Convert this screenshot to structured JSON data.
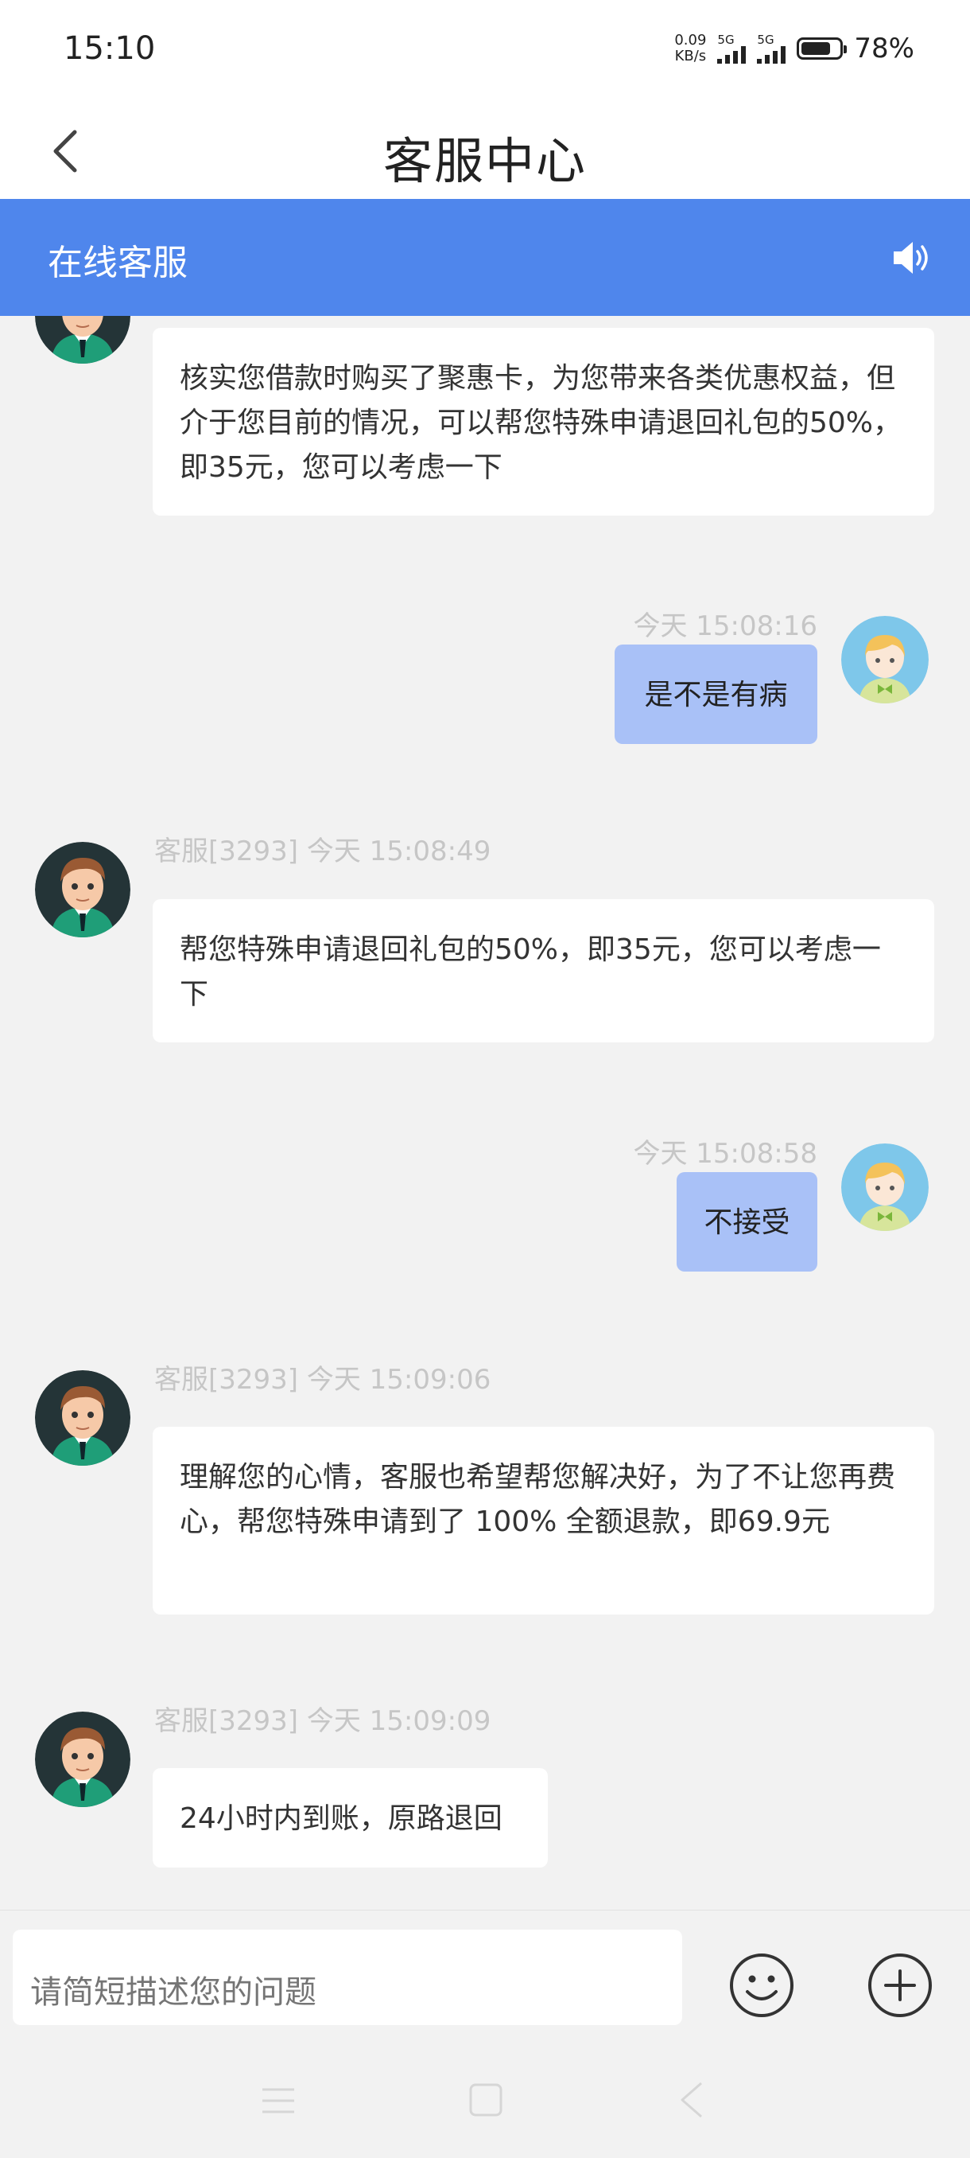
{
  "status": {
    "time": "15:10",
    "net_speed_top": "0.09",
    "net_speed_bottom": "KB/s",
    "sim1": "5G",
    "sim2": "5G",
    "battery": "78%",
    "battery_level": 0.78
  },
  "header": {
    "title": "客服中心",
    "banner_title": "在线客服"
  },
  "messages": [
    {
      "from": "agent",
      "meta": "",
      "text": "核实您借款时购买了聚惠卡，为您带来各类优惠权益，但介于您目前的情况，可以帮您特殊申请退回礼包的50%，即35元，您可以考虑一下"
    },
    {
      "from": "user",
      "meta": "今天 15:08:16",
      "text": "是不是有病"
    },
    {
      "from": "agent",
      "meta": "客服[3293]  今天 15:08:49",
      "text": "帮您特殊申请退回礼包的50%，即35元，您可以考虑一下"
    },
    {
      "from": "user",
      "meta": "今天 15:08:58",
      "text": "不接受"
    },
    {
      "from": "agent",
      "meta": "客服[3293]  今天 15:09:06",
      "text": "理解您的心情，客服也希望帮您解决好，为了不让您再费心，帮您特殊申请到了 100% 全额退款，即69.9元"
    },
    {
      "from": "agent",
      "meta": "客服[3293]  今天 15:09:09",
      "text": "24小时内到账，原路退回"
    }
  ],
  "input": {
    "placeholder": "请简短描述您的问题"
  },
  "icons": {
    "back": "back-arrow-icon",
    "speaker": "speaker-icon",
    "emoji": "emoji-icon",
    "plus": "plus-circle-icon",
    "agent_avatar": "agent-avatar",
    "user_avatar": "user-avatar"
  },
  "colors": {
    "accent": "#4f86ec",
    "user_bubble": "#a9c1f7",
    "background": "#f2f2f2"
  }
}
